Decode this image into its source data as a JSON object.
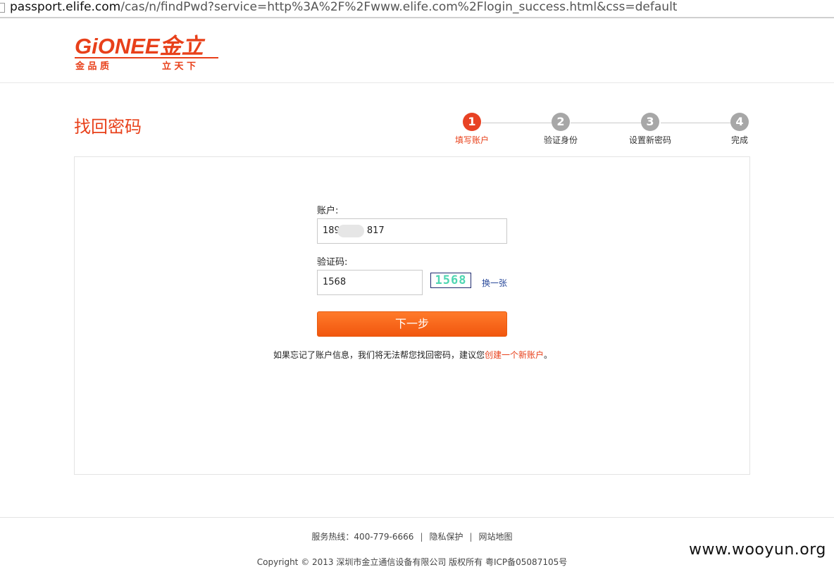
{
  "browser": {
    "url_host": "passport.elife.com",
    "url_path": "/cas/n/findPwd?service=http%3A%2F%2Fwww.elife.com%2Flogin_success.html&css=default"
  },
  "logo": {
    "brand_text": "GiONEE金立",
    "slogan_left": "金 品 质",
    "slogan_right": "立 天 下"
  },
  "page": {
    "title": "找回密码"
  },
  "steps": [
    {
      "number": "1",
      "label": "填写账户",
      "active": true
    },
    {
      "number": "2",
      "label": "验证身份",
      "active": false
    },
    {
      "number": "3",
      "label": "设置新密码",
      "active": false
    },
    {
      "number": "4",
      "label": "完成",
      "active": false
    }
  ],
  "form": {
    "account_label": "账户:",
    "account_value_prefix": "189",
    "account_value_suffix": "817",
    "captcha_label": "验证码:",
    "captcha_value": "1568",
    "captcha_image_text": "1568",
    "refresh_label": "换一张",
    "next_button": "下一步"
  },
  "hint": {
    "text": "如果忘记了账户信息，我们将无法帮您找回密码，建议您",
    "link": "创建一个新账户",
    "end": "。"
  },
  "footer": {
    "hotline": "服务热线：400-779-6666",
    "sep": "|",
    "privacy": "隐私保护",
    "sitemap": "网站地图",
    "copyright": "Copyright © 2013 深圳市金立通信设备有限公司 版权所有 粤ICP备05087105号"
  },
  "watermark": "www.wooyun.org",
  "colors": {
    "accent": "#e8401a",
    "button": "#f1560e",
    "step_inactive": "#a7a7a7"
  }
}
